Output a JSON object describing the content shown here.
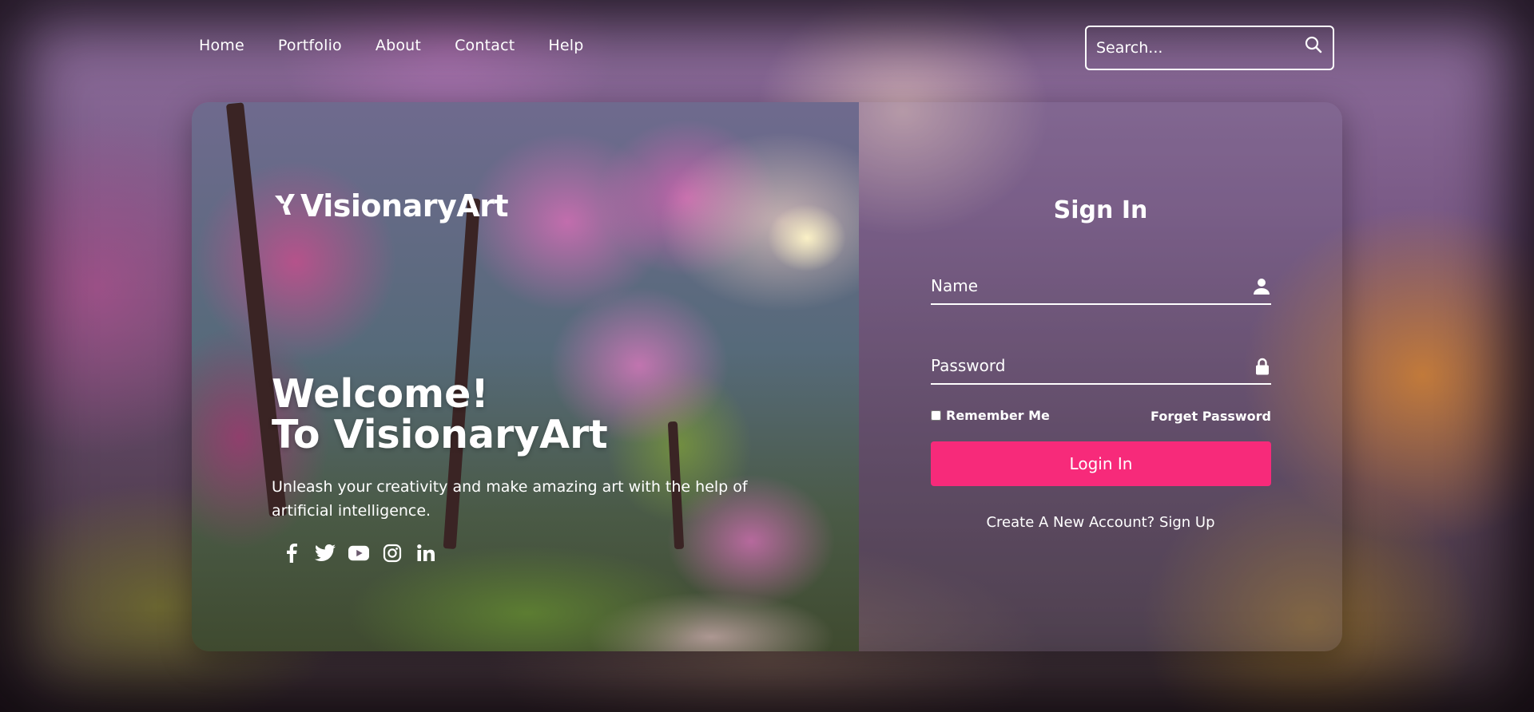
{
  "nav": {
    "items": [
      {
        "label": "Home"
      },
      {
        "label": "Portfolio"
      },
      {
        "label": "About"
      },
      {
        "label": "Contact"
      },
      {
        "label": "Help"
      }
    ]
  },
  "search": {
    "placeholder": "Search...",
    "icon": "search-icon"
  },
  "hero": {
    "brand": "VisionaryArt",
    "welcome_line1": "Welcome!",
    "welcome_line2": "To VisionaryArt",
    "tagline": "Unleash your creativity and make amazing art with the help of artificial intelligence.",
    "social_icons": [
      "facebook-icon",
      "twitter-icon",
      "youtube-icon",
      "instagram-icon",
      "linkedin-icon"
    ]
  },
  "signin": {
    "title": "Sign In",
    "name_placeholder": "Name",
    "password_placeholder": "Password",
    "remember_label": "Remember Me",
    "remember_checked": false,
    "forget_label": "Forget Password",
    "login_label": "Login In",
    "signup_label": "Create A New Account? Sign Up"
  },
  "colors": {
    "accent": "#f72a7a",
    "text": "#ffffff"
  }
}
